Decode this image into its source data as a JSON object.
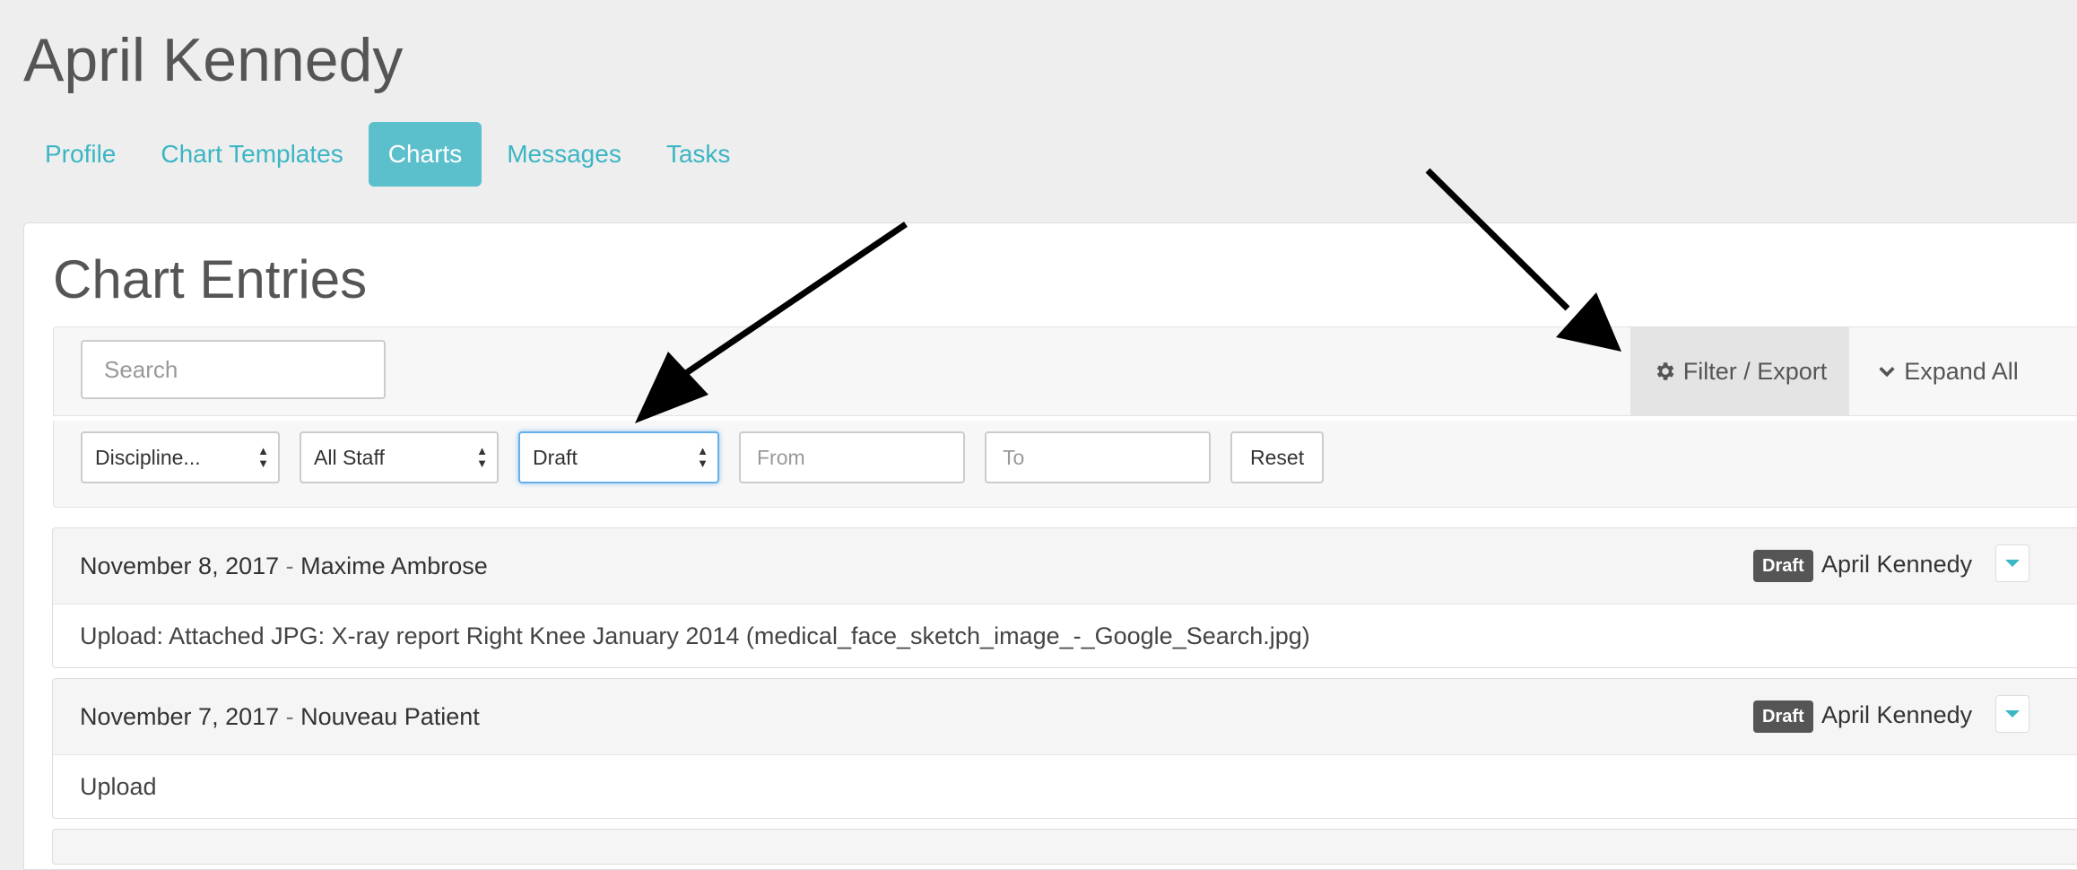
{
  "patient": {
    "name": "April Kennedy"
  },
  "tabs": [
    {
      "label": "Profile",
      "active": false
    },
    {
      "label": "Chart Templates",
      "active": false
    },
    {
      "label": "Charts",
      "active": true
    },
    {
      "label": "Messages",
      "active": false
    },
    {
      "label": "Tasks",
      "active": false
    }
  ],
  "panel": {
    "title": "Chart Entries"
  },
  "toolbar": {
    "search_placeholder": "Search",
    "filter_export_label": "Filter / Export",
    "expand_all_label": "Expand All"
  },
  "filters": {
    "discipline": "Discipline...",
    "staff": "All Staff",
    "status": "Draft",
    "from_placeholder": "From",
    "to_placeholder": "To",
    "reset_label": "Reset"
  },
  "entries": [
    {
      "date": "November 8, 2017",
      "separator": "-",
      "patient": "Maxime Ambrose",
      "badge": "Draft",
      "author": "April Kennedy",
      "body": "Upload: Attached JPG: X-ray report Right Knee January 2014 (medical_face_sketch_image_-_Google_Search.jpg)"
    },
    {
      "date": "November 7, 2017",
      "separator": "-",
      "patient": "Nouveau Patient",
      "badge": "Draft",
      "author": "April Kennedy",
      "body": "Upload"
    }
  ],
  "colors": {
    "accent": "#5bc0cc",
    "link": "#3bb6c4",
    "badge": "#555555",
    "background": "#eeeeee"
  },
  "icons": {
    "filter": "gear-icon",
    "expand": "chevron-down-icon",
    "entry_toggle": "caret-down-icon"
  }
}
